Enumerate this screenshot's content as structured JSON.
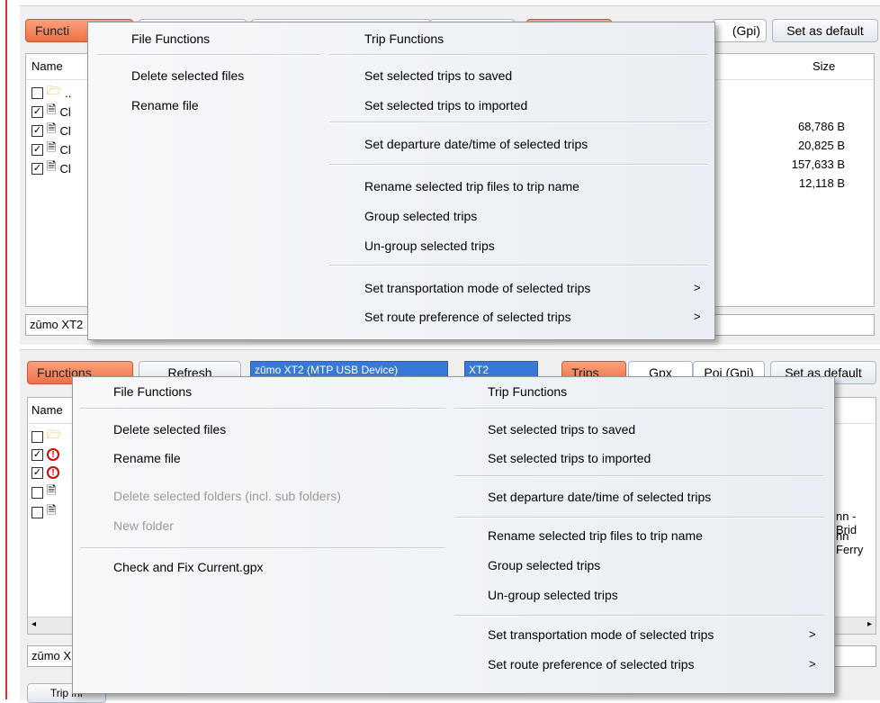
{
  "top": {
    "functions_label": "Functi",
    "gpi_label": "(Gpi)",
    "set_default_label": "Set as default",
    "col_name": "Name",
    "col_size": "Size",
    "rows": [
      {
        "name": "..",
        "checked": false
      },
      {
        "name": "Cl",
        "checked": true
      },
      {
        "name": "Cl",
        "checked": true
      },
      {
        "name": "Cl",
        "checked": true
      },
      {
        "name": "Cl",
        "checked": true
      }
    ],
    "sizes": [
      "68,786 B",
      "20,825 B",
      "157,633 B",
      "12,118 B"
    ],
    "device_field": "zūmo XT2"
  },
  "top_menu": {
    "left_header": "File Functions",
    "left_items": [
      "Delete selected files",
      "Rename file"
    ],
    "right_header": "Trip Functions",
    "right_items": [
      "Set selected trips to saved",
      "Set selected trips to imported",
      "Set departure date/time of selected trips",
      "Rename selected trip files to trip name",
      "Group selected trips",
      "Un-group selected trips",
      "Set transportation mode of selected trips",
      "Set route preference of selected trips"
    ],
    "submenu_arrow": ">"
  },
  "bottom": {
    "functions_label": "Functions",
    "refresh_label": "Refresh",
    "device_select": "zūmo XT2 (MTP USB Device)",
    "model_select": "XT2",
    "tab_trips": "Trips",
    "tab_gpx": "Gpx",
    "tab_poi": "Poi (Gpi)",
    "set_default_label": "Set as default",
    "col_name": "Name",
    "rows": [
      {
        "checked": false,
        "kind": "folder"
      },
      {
        "checked": true,
        "kind": "warn"
      },
      {
        "checked": true,
        "kind": "warn"
      },
      {
        "checked": false,
        "kind": "file"
      },
      {
        "checked": false,
        "kind": "file"
      }
    ],
    "right_text_1": "nn - Brid",
    "right_text_2": "nn Ferry",
    "device_field": "zūmo X",
    "tripinfo_tab": "Trip inf"
  },
  "bottom_menu": {
    "left_header": "File Functions",
    "left_items": [
      "Delete selected files",
      "Rename file"
    ],
    "left_disabled": [
      "Delete selected folders (incl. sub folders)",
      "New folder"
    ],
    "left_check": "Check and Fix Current.gpx",
    "right_header": "Trip Functions",
    "right_items": [
      "Set selected trips to saved",
      "Set selected trips to imported",
      "Set departure date/time of selected trips",
      "Rename selected trip files to trip name",
      "Group selected trips",
      "Un-group selected trips",
      "Set transportation mode of selected trips",
      "Set route preference of selected trips"
    ],
    "submenu_arrow": ">"
  }
}
